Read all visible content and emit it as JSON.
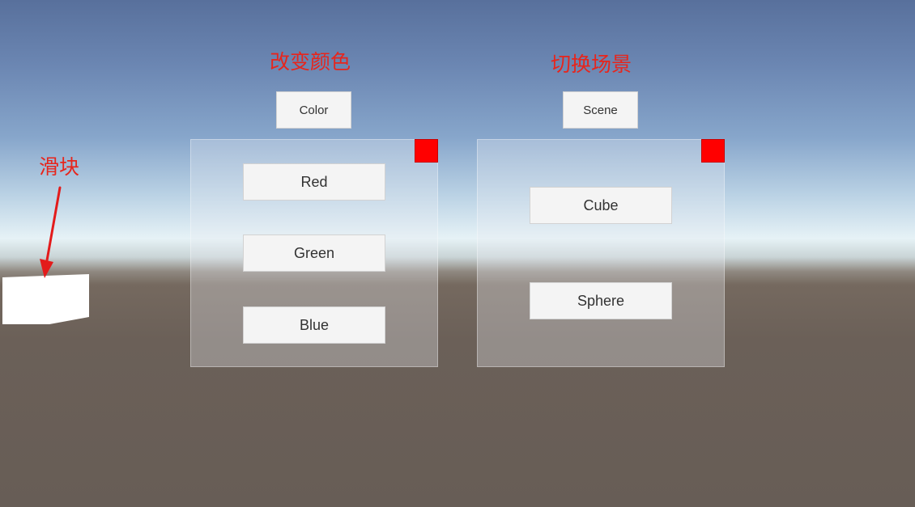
{
  "headings": {
    "change_color": "改变颜色",
    "switch_scene": "切换场景",
    "slider": "滑块"
  },
  "top_buttons": {
    "color_label": "Color",
    "scene_label": "Scene"
  },
  "color_panel": {
    "buttons": [
      "Red",
      "Green",
      "Blue"
    ]
  },
  "scene_panel": {
    "buttons": [
      "Cube",
      "Sphere"
    ]
  },
  "colors": {
    "heading_text": "#e7251c",
    "close_square": "#ff0000",
    "button_bg": "#f4f4f4",
    "button_text": "#323232",
    "slider_block": "#ffffff"
  },
  "icons": {
    "panel_close": "red-square-icon",
    "slider_pointer": "arrow-icon"
  }
}
